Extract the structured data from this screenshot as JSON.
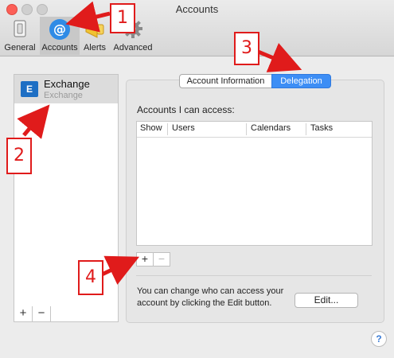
{
  "window": {
    "title": "Accounts"
  },
  "toolbar": {
    "items": [
      {
        "label": "General",
        "icon": "switch-icon",
        "selected": false
      },
      {
        "label": "Accounts",
        "icon": "at-sign-icon",
        "selected": true
      },
      {
        "label": "Alerts",
        "icon": "megaphone-icon",
        "selected": false
      },
      {
        "label": "Advanced",
        "icon": "gear-icon",
        "selected": false
      }
    ]
  },
  "sidebar": {
    "accounts": [
      {
        "name": "Exchange",
        "type": "Exchange",
        "icon": "exchange-icon",
        "selected": true
      }
    ],
    "add_label": "+",
    "remove_label": "−"
  },
  "tabs": {
    "items": [
      {
        "label": "Account Information",
        "active": false
      },
      {
        "label": "Delegation",
        "active": true
      }
    ],
    "active_color": "#3d8ef5"
  },
  "delegation": {
    "accounts_label": "Accounts I can access:",
    "columns": [
      "Show",
      "Users",
      "Calendars",
      "Tasks"
    ],
    "rows": [],
    "add_label": "+",
    "remove_label": "−",
    "edit_text": "You can change who can access your account by clicking the Edit button.",
    "edit_button": "Edit..."
  },
  "help": {
    "label": "?"
  },
  "annotations": {
    "color": "#e01b1b",
    "markers": [
      "1",
      "2",
      "3",
      "4"
    ]
  }
}
